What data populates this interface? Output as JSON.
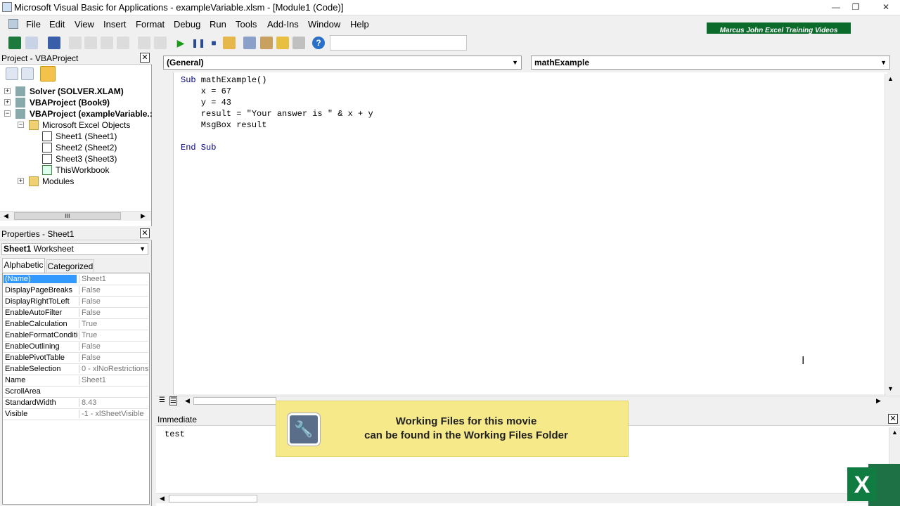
{
  "window": {
    "title": "Microsoft Visual Basic for Applications - exampleVariable.xlsm - [Module1 (Code)]",
    "minimize_glyph": "—",
    "restore_glyph": "❐",
    "close_glyph": "✕"
  },
  "menu": [
    "File",
    "Edit",
    "View",
    "Insert",
    "Format",
    "Debug",
    "Run",
    "Tools",
    "Add-Ins",
    "Window",
    "Help"
  ],
  "brand_banner": "Marcus John Excel Training Videos",
  "project_panel": {
    "title": "Project - VBAProject",
    "items": [
      {
        "label": "Solver (SOLVER.XLAM)",
        "bold": true
      },
      {
        "label": "VBAProject (Book9)",
        "bold": true
      },
      {
        "label": "VBAProject (exampleVariable.:",
        "bold": true
      },
      {
        "label": "Microsoft Excel Objects",
        "bold": false
      },
      {
        "label": "Sheet1 (Sheet1)",
        "bold": false
      },
      {
        "label": "Sheet2 (Sheet2)",
        "bold": false
      },
      {
        "label": "Sheet3 (Sheet3)",
        "bold": false
      },
      {
        "label": "ThisWorkbook",
        "bold": false
      },
      {
        "label": "Modules",
        "bold": false
      }
    ],
    "hscroll_grip": "III"
  },
  "properties_panel": {
    "title": "Properties - Sheet1",
    "object_name": "Sheet1",
    "object_type": "Worksheet",
    "tabs": [
      "Alphabetic",
      "Categorized"
    ],
    "rows": [
      {
        "name": "(Name)",
        "value": "Sheet1"
      },
      {
        "name": "DisplayPageBreaks",
        "value": "False"
      },
      {
        "name": "DisplayRightToLeft",
        "value": "False"
      },
      {
        "name": "EnableAutoFilter",
        "value": "False"
      },
      {
        "name": "EnableCalculation",
        "value": "True"
      },
      {
        "name": "EnableFormatConditic",
        "value": "True"
      },
      {
        "name": "EnableOutlining",
        "value": "False"
      },
      {
        "name": "EnablePivotTable",
        "value": "False"
      },
      {
        "name": "EnableSelection",
        "value": "0 - xlNoRestrictions"
      },
      {
        "name": "Name",
        "value": "Sheet1"
      },
      {
        "name": "ScrollArea",
        "value": ""
      },
      {
        "name": "StandardWidth",
        "value": "8.43"
      },
      {
        "name": "Visible",
        "value": "-1 - xlSheetVisible"
      }
    ]
  },
  "code_window": {
    "object_combo": "(General)",
    "proc_combo": "mathExample",
    "lines": [
      "Sub mathExample()",
      "    x = 67",
      "    y = 43",
      "    result = \"Your answer is \" & x + y",
      "    MsgBox result",
      "",
      "End Sub"
    ]
  },
  "immediate_window": {
    "title": "Immediate",
    "content": "test"
  },
  "toast": {
    "line1": "Working Files for this movie",
    "line2": "can be found in the Working Files Folder"
  },
  "colors": {
    "selection": "#3399ff",
    "keyword": "#00007f",
    "brand": "#0b6b2b",
    "toast": "#f5e98a"
  }
}
